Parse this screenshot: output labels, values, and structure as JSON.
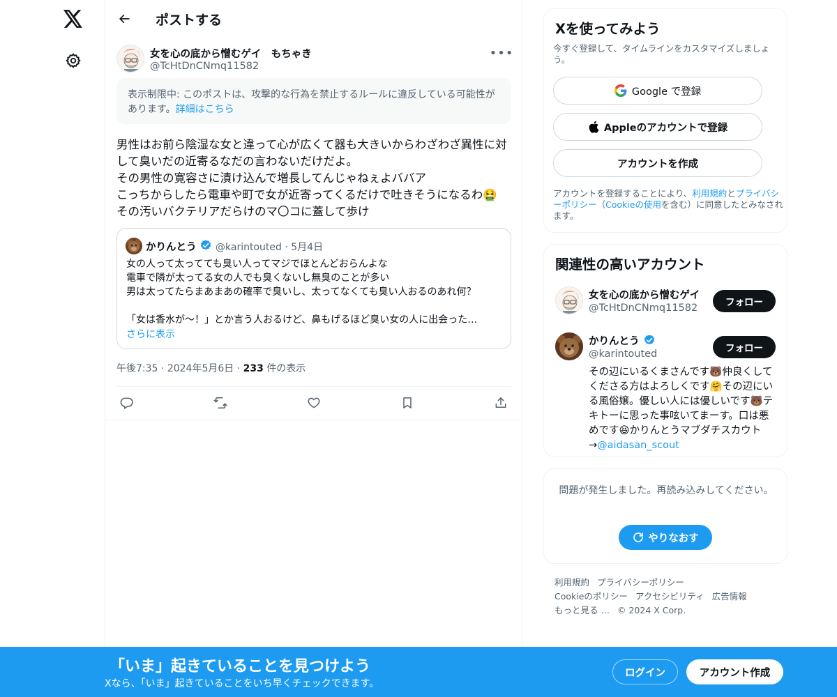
{
  "header": {
    "title": "ポストする"
  },
  "post": {
    "author_name": "女を心の底から憎むゲイ　もちゃき",
    "author_handle": "@TcHtDnCNmq11582",
    "warning_text": "表示制限中: このポストは、攻撃的な行為を禁止するルールに違反している可能性があります。",
    "warning_link": "詳細はこちら",
    "text": "男性はお前ら陰湿な女と違って心が広くて器も大きいからわざわざ異性に対して臭いだの近寄るなだの言わないだけだよ。\nその男性の寛容さに漬け込んで増長してんじゃねぇよババア\nこっちからしたら電車や町で女が近寄ってくるだけで吐きそうになるわ🤮\nその汚いバクテリアだらけのマ〇コに蓋して歩け",
    "time": "午後7:35",
    "date": "2024年5月6日",
    "views_count": "233",
    "views_label": "件の表示"
  },
  "quote": {
    "name": "かりんとう",
    "handle": "@karintouted",
    "date": "5月4日",
    "text": "女の人って太ってても臭い人ってマジでほとんどおらんよな\n電車で隣が太ってる女の人でも臭くないし無臭のことが多い\n男は太ってたらまあまあの確率で臭いし、太ってなくても臭い人おるのあれ何？\n\n「女は香水が〜！」とか言う人おるけど、鼻もげるほど臭い女の人に出会った…",
    "show_more": "さらに表示"
  },
  "signup_card": {
    "title": "Xを使ってみよう",
    "subtitle": "今すぐ登録して、タイムラインをカスタマイズしましょう。",
    "google_label": "Google で登録",
    "apple_label": "Appleのアカウントで登録",
    "create_label": "アカウントを作成",
    "legal_prefix": "アカウントを登録することにより、",
    "terms_link": "利用規約",
    "legal_and": "と",
    "privacy_link": "プライバシーポリシー",
    "legal_paren_open": "（",
    "cookie_link": "Cookieの使用",
    "legal_suffix": "を含む）に同意したとみなされます。"
  },
  "relevant": {
    "title": "関連性の高いアカウント",
    "accounts": [
      {
        "name": "女を心の底から憎むゲイ",
        "handle": "@TcHtDnCNmq11582",
        "follow": "フォロー"
      },
      {
        "name": "かりんとう",
        "handle": "@karintouted",
        "follow": "フォロー",
        "bio": "その辺にいるくまさんです🐻仲良くしてくださる方はよろしくです🤗その辺にいる風俗嬢。優しい人には優しいです🐻テキトーに思った事呟いてまーす。口は悪めです😆かりんとうマブダチスカウト→",
        "bio_mention": "@aidasan_scout"
      }
    ]
  },
  "error_card": {
    "text": "問題が発生しました。再読み込みしてください。",
    "retry": "やりなおす"
  },
  "footer": {
    "links": [
      "利用規約",
      "プライバシーポリシー",
      "Cookieのポリシー",
      "アクセシビリティ",
      "広告情報",
      "もっと見る …"
    ],
    "copyright": "© 2024 X Corp."
  },
  "bottom_bar": {
    "title": "「いま」起きていることを見つけよう",
    "subtitle": "Xなら、「いま」起きていることをいち早くチェックできます。",
    "login": "ログイン",
    "signup": "アカウント作成"
  },
  "colors": {
    "accent": "#1d9bf0",
    "text": "#0f1419",
    "muted": "#536471",
    "border": "#cfd9de"
  },
  "icons": [
    "x-logo-icon",
    "gear-icon",
    "back-arrow-icon",
    "more-icon",
    "verified-icon",
    "reply-icon",
    "repost-icon",
    "like-icon",
    "bookmark-icon",
    "share-icon",
    "google-icon",
    "apple-icon",
    "refresh-icon"
  ]
}
